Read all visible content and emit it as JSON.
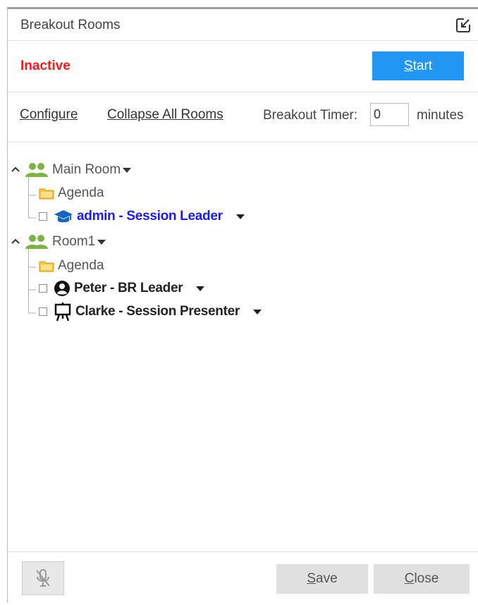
{
  "header": {
    "title": "Breakout Rooms",
    "popout_icon": "popout-icon"
  },
  "status": {
    "text": "Inactive",
    "start_label_first": "S",
    "start_label_rest": "tart"
  },
  "toolbar": {
    "configure_label": "Configure",
    "collapse_label": "Collapse All Rooms",
    "timer_label": "Breakout Timer:",
    "timer_value": "0",
    "minutes_label": "minutes"
  },
  "rooms": [
    {
      "name": "Main Room",
      "agenda": "Agenda",
      "users": [
        {
          "label": "admin - Session Leader",
          "role_icon": "graduation-cap-icon",
          "highlight": true
        }
      ]
    },
    {
      "name": "Room1",
      "agenda": "Agenda",
      "users": [
        {
          "label": "Peter - BR Leader",
          "role_icon": "person-circle-icon",
          "highlight": false
        },
        {
          "label": "Clarke - Session Presenter",
          "role_icon": "presenter-easel-icon",
          "highlight": false
        }
      ]
    }
  ],
  "footer": {
    "mic_icon": "mic-off-icon",
    "save_label_first": "S",
    "save_label_rest": "ave",
    "close_label_first": "C",
    "close_label_rest": "lose"
  },
  "colors": {
    "inactive": "#ff1a1a",
    "accent": "#2196f3",
    "leader_text": "#1a1aff",
    "room_icon": "#7cb342",
    "folder": "#f9c63a"
  }
}
